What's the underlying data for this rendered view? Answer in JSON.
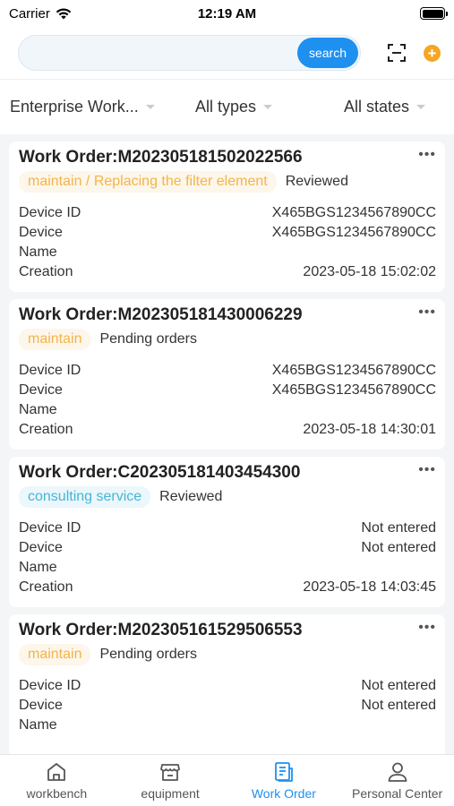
{
  "status_bar": {
    "carrier": "Carrier",
    "time": "12:19 AM"
  },
  "search": {
    "placeholder": "",
    "button_label": "search"
  },
  "filters": {
    "enterprise": "Enterprise Work...",
    "types": "All types",
    "states": "All states"
  },
  "orders": [
    {
      "title": "Work Order:M202305181502022566",
      "tag": "maintain / Replacing the filter element",
      "tag_type": "maintain",
      "state": "Reviewed",
      "device_id_label": "Device ID",
      "device_id": "X465BGS1234567890CC",
      "device_name_label": "Device Name",
      "device_name": "X465BGS1234567890CC",
      "creation_label": "Creation",
      "creation": "2023-05-18 15:02:02"
    },
    {
      "title": "Work Order:M202305181430006229",
      "tag": "maintain",
      "tag_type": "maintain",
      "state": "Pending orders",
      "device_id_label": "Device ID",
      "device_id": "X465BGS1234567890CC",
      "device_name_label": "Device Name",
      "device_name": "X465BGS1234567890CC",
      "creation_label": "Creation",
      "creation": "2023-05-18 14:30:01"
    },
    {
      "title": "Work Order:C202305181403454300",
      "tag": "consulting service",
      "tag_type": "consult",
      "state": "Reviewed",
      "device_id_label": "Device ID",
      "device_id": "Not entered",
      "device_name_label": "Device Name",
      "device_name": "Not entered",
      "creation_label": "Creation",
      "creation": "2023-05-18 14:03:45"
    },
    {
      "title": "Work Order:M202305161529506553",
      "tag": "maintain",
      "tag_type": "maintain",
      "state": "Pending orders",
      "device_id_label": "Device ID",
      "device_id": "Not entered",
      "device_name_label": "Device Name",
      "device_name": "Not entered",
      "creation_label": "",
      "creation": ""
    }
  ],
  "tabs": [
    {
      "label": "workbench",
      "icon": "home-icon",
      "active": false
    },
    {
      "label": "equipment",
      "icon": "store-icon",
      "active": false
    },
    {
      "label": "Work Order",
      "icon": "document-icon",
      "active": true
    },
    {
      "label": "Personal Center",
      "icon": "user-icon",
      "active": false
    }
  ],
  "colors": {
    "accent": "#1e90f0",
    "maintain": "#f2b54a",
    "consult": "#46b5d8",
    "add": "#f5a623"
  }
}
